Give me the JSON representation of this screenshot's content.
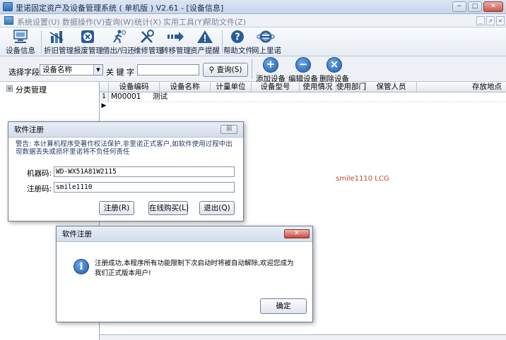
{
  "window": {
    "title": "里诺固定资产及设备管理系统 ( 单机版 ) V2.61 - [设备信息]",
    "min": "−",
    "max": "□",
    "close": "✕"
  },
  "menubar": {
    "items": [
      "系统设置(U)",
      "数据操作(V)",
      "查询(W)",
      "统计(X)",
      "实用工具(Y)",
      "帮助文件(Z)"
    ],
    "mdi": [
      "_",
      "⇗",
      "×"
    ]
  },
  "toolbar": {
    "items": [
      "设备信息",
      "折旧管理",
      "报废管理",
      "借出/归还",
      "维修管理",
      "转移管理",
      "资产提醒",
      "帮助文件",
      "网上里诺"
    ]
  },
  "search": {
    "field_label": "选择字段",
    "field_value": "设备名称",
    "keyword_label": "关 键 字",
    "keyword_value": "",
    "query_button": "查询(S)",
    "add": "添加设备",
    "edit": "编辑设备",
    "delete": "删除设备"
  },
  "tree": {
    "root": "分类管理",
    "expander": "⊞"
  },
  "grid": {
    "columns": [
      "设备编码",
      "设备名称",
      "计量单位",
      "设备型号",
      "使用情况",
      "使用部门",
      "保管人员",
      "存放地点"
    ],
    "rows": [
      {
        "indicator": "1 ▶",
        "code": "M00001",
        "name": "测试"
      }
    ]
  },
  "watermark": "smile1110 LCG",
  "register_dialog": {
    "title": "软件注册",
    "close": "☒",
    "warning": "警告: 本计算机程序受著作权法保护,非里诺正式客户,如软件使用过程中出现数据丢失或损坏里诺将不负任何责任",
    "machine_label": "机器码:",
    "machine_code": "WD-WX51A81W2115",
    "reg_label": "注册码:",
    "reg_code": "smile1110",
    "btn_register": "注册(R)",
    "btn_buy": "在线购买(L)",
    "btn_exit": "退出(Q)"
  },
  "success_dialog": {
    "title": "软件注册",
    "close": "✕",
    "info_glyph": "i",
    "message_line1": "注册成功,本程序所有功能限制下次启动时将被自动解除,欢迎您成为",
    "message_line2": "我们正式版本用户!",
    "ok": "确定"
  }
}
